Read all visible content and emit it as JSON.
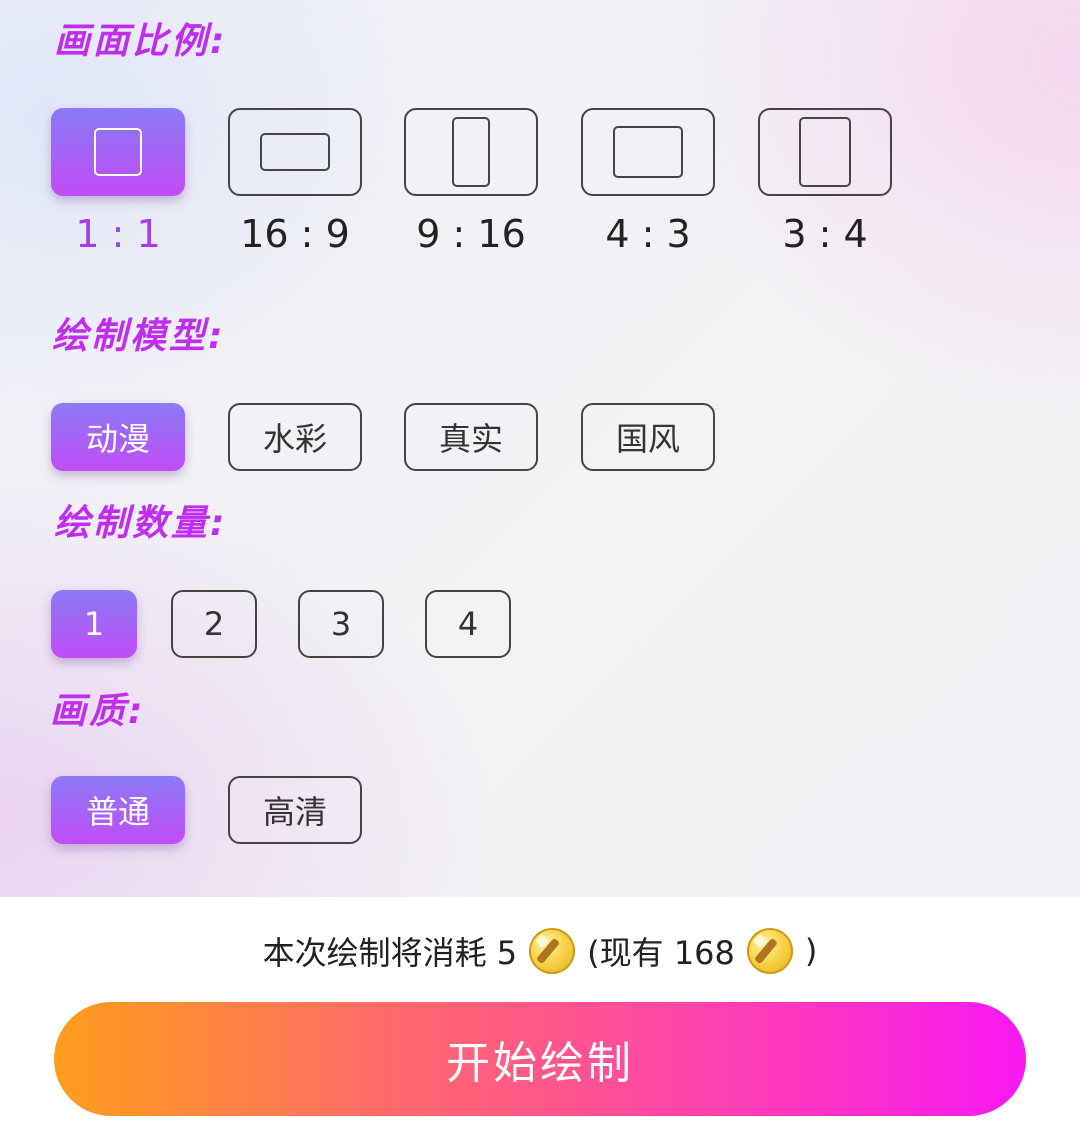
{
  "sections": {
    "ratio": {
      "title": "画面比例:",
      "selected": "1 : 1",
      "options": [
        {
          "label": "1 : 1",
          "icon": "square-frame-icon"
        },
        {
          "label": "16 : 9",
          "icon": "landscape-frame-icon"
        },
        {
          "label": "9 : 16",
          "icon": "portrait-frame-icon"
        },
        {
          "label": "4 : 3",
          "icon": "landscape-frame-icon"
        },
        {
          "label": "3 : 4",
          "icon": "portrait-frame-icon"
        }
      ]
    },
    "model": {
      "title": "绘制模型:",
      "selected": "动漫",
      "options": [
        "动漫",
        "水彩",
        "真实",
        "国风"
      ]
    },
    "count": {
      "title": "绘制数量:",
      "selected": "1",
      "options": [
        "1",
        "2",
        "3",
        "4"
      ]
    },
    "quality": {
      "title": "画质:",
      "selected": "普通",
      "options": [
        "普通",
        "高清"
      ]
    }
  },
  "footer": {
    "cost_prefix": "本次绘制将消耗 5",
    "balance_prefix": "(现有 168",
    "balance_suffix": ")",
    "coin_icon": "magic-wand-coin-icon",
    "start_button_label": "开始绘制"
  },
  "colors": {
    "accent_title": "#c02df0",
    "selected_gradient": [
      "#8a7af6",
      "#c14cf6"
    ],
    "start_gradient": [
      "#ff9d1c",
      "#f918f2"
    ]
  }
}
